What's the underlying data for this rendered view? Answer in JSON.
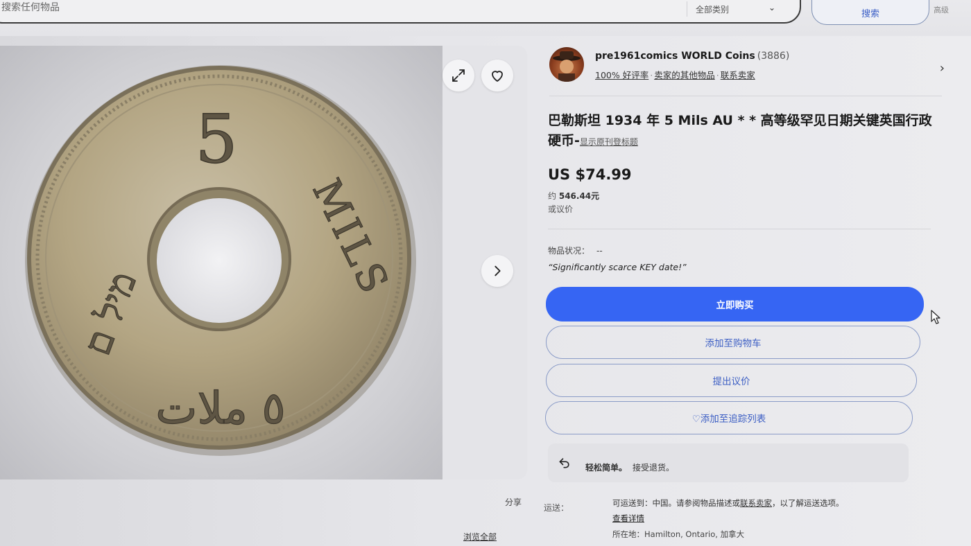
{
  "search": {
    "placeholder": "搜索任何物品",
    "category": "全部类别",
    "button_label": "搜索",
    "advanced_label": "高级"
  },
  "gallery": {
    "coin": {
      "top_numeral": "5",
      "right_legend": "MILS",
      "left_legend": "מיל ם",
      "bottom_legend": "٥ ملات"
    }
  },
  "seller": {
    "name": "pre1961comics WORLD Coins",
    "feedback_count": "(3886)",
    "positive": "100% 好评率",
    "other_items": "卖家的其他物品",
    "contact": "联系卖家"
  },
  "item": {
    "title": "巴勒斯坦 1934 年 5 Mils AU * * 高等级罕见日期关键英国行政硬币-",
    "show_original_title": "显示原刊登标题"
  },
  "pricing": {
    "price": "US $74.99",
    "approx_prefix": "约",
    "approx_value": "546.44元",
    "best_offer": "或议价"
  },
  "condition": {
    "label": "物品状况：",
    "value": "--",
    "note": "“Significantly scarce KEY date!”"
  },
  "actions": {
    "buy_now": "立即购买",
    "add_to_cart": "添加至购物车",
    "make_offer": "提出议价",
    "add_to_watchlist": "♡添加至追踪列表"
  },
  "returns": {
    "title": "轻松简单。",
    "text": "接受退货。"
  },
  "links": {
    "share": "分享",
    "view_all": "浏览全部"
  },
  "shipping": {
    "label": "运送：",
    "text_before": "可运送到：中国。请参阅物品描述或",
    "contact_link": "联系卖家",
    "text_after": "，以了解运送选项。",
    "details_link": "查看详情",
    "location": "所在地：Hamilton, Ontario, 加拿大"
  },
  "colors": {
    "accent_blue": "#3665f3",
    "outline_blue": "#8a9bc7"
  }
}
